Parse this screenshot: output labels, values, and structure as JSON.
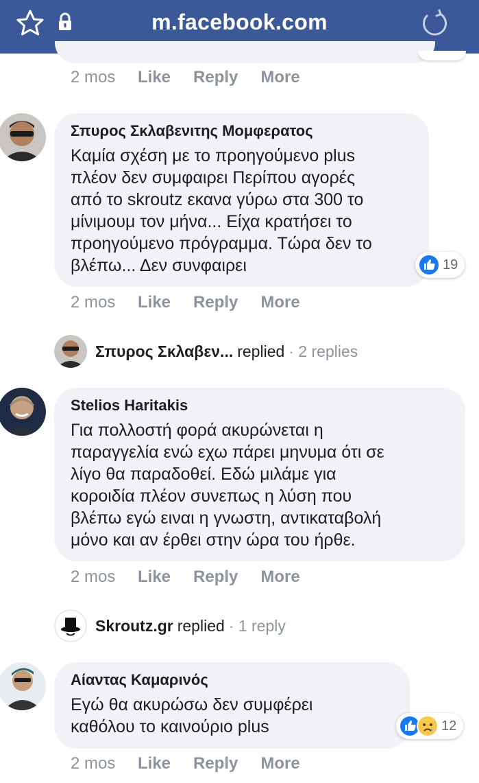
{
  "browser": {
    "url": "m.facebook.com",
    "icons": [
      "star-icon",
      "lock-icon",
      "reload-icon"
    ]
  },
  "actions": {
    "like": "Like",
    "reply": "Reply",
    "more": "More"
  },
  "comments": [
    {
      "time": "2 mos"
    },
    {
      "author": "Σπυρος Σκλαβενιτης Μομφερατος",
      "text": "Καμία σχέση με το προηγούμενο plus\nπλέον δεν συμφαιρει Περίπου αγορές\nαπό το skroutz εκανα γύρω στα 300 το\nμίνιμουμ τον μήνα... Είχα κρατήσει το\nπροηγούμενο πρόγραμμα. Τώρα δεν το\nβλέπω... Δεν συνφαιρει",
      "reactions": "19",
      "time": "2 mos",
      "reply": {
        "name": "Σπυρος Σκλαβεν...",
        "replied": "replied",
        "count": "· 2 replies"
      }
    },
    {
      "author": "Stelios Haritakis",
      "text": "Για πολλοστή φορά ακυρώνεται η\nπαραγγελία ενώ εχω πάρει μηνυμα ότι σε\nλίγο θα παραδοθεί. Εδώ μιλάμε για\nκοροιδία πλέον συνεπως η λύση που\nβλέπω εγώ ειναι η γνωστη, αντικαταβολή\nμόνο και αν έρθει στην ώρα του ήρθε.",
      "time": "2 mos",
      "reply": {
        "name": "Skroutz.gr",
        "replied": "replied",
        "count": "· 1 reply"
      }
    },
    {
      "author": "Αίαντας Καμαρινός",
      "text": "Εγώ θα ακυρώσω δεν συμφέρει\nκαθόλου το καινούριο plus",
      "reactions": "12",
      "time": "2 mos"
    }
  ],
  "colors": {
    "header": "#3b5998",
    "bubble": "#f0f2f5",
    "meta": "#8d949e",
    "like": "#1877f2"
  }
}
